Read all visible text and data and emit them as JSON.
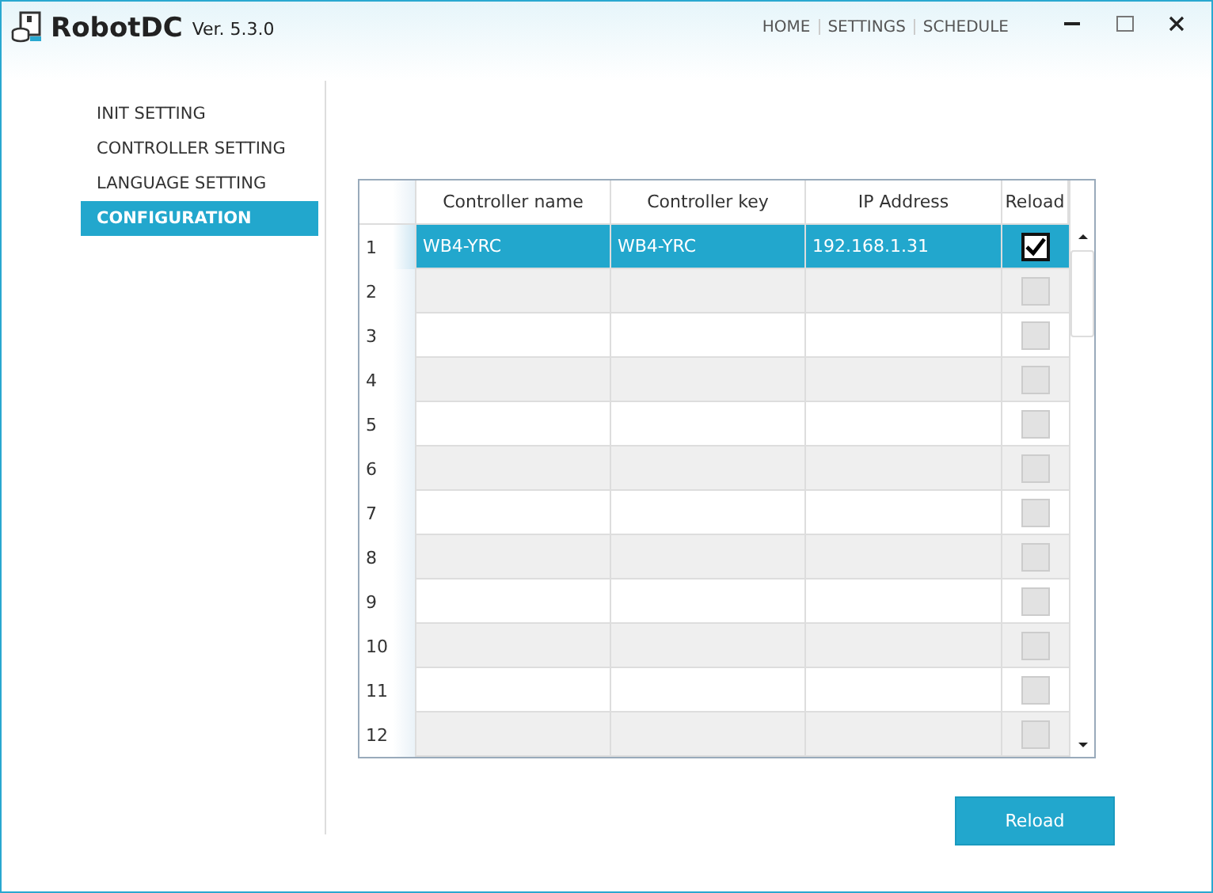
{
  "window": {
    "title": "RobotDC",
    "version": "Ver. 5.3.0"
  },
  "nav": [
    {
      "label": "HOME"
    },
    {
      "label": "SETTINGS"
    },
    {
      "label": "SCHEDULE"
    }
  ],
  "sidebar": {
    "items": [
      {
        "label": "INIT SETTING",
        "selected": false
      },
      {
        "label": "CONTROLLER SETTING",
        "selected": false
      },
      {
        "label": "LANGUAGE SETTING",
        "selected": false
      },
      {
        "label": "CONFIGURATION",
        "selected": true
      }
    ]
  },
  "table": {
    "columns": [
      "Controller name",
      "Controller key",
      "IP Address",
      "Reload"
    ],
    "rows": [
      {
        "index": "1",
        "name": "WB4-YRC",
        "key": "WB4-YRC",
        "ip": "192.168.1.31",
        "reload": true,
        "enabled": true,
        "selected": true
      },
      {
        "index": "2",
        "name": "",
        "key": "",
        "ip": "",
        "reload": false,
        "enabled": false,
        "selected": false
      },
      {
        "index": "3",
        "name": "",
        "key": "",
        "ip": "",
        "reload": false,
        "enabled": false,
        "selected": false
      },
      {
        "index": "4",
        "name": "",
        "key": "",
        "ip": "",
        "reload": false,
        "enabled": false,
        "selected": false
      },
      {
        "index": "5",
        "name": "",
        "key": "",
        "ip": "",
        "reload": false,
        "enabled": false,
        "selected": false
      },
      {
        "index": "6",
        "name": "",
        "key": "",
        "ip": "",
        "reload": false,
        "enabled": false,
        "selected": false
      },
      {
        "index": "7",
        "name": "",
        "key": "",
        "ip": "",
        "reload": false,
        "enabled": false,
        "selected": false
      },
      {
        "index": "8",
        "name": "",
        "key": "",
        "ip": "",
        "reload": false,
        "enabled": false,
        "selected": false
      },
      {
        "index": "9",
        "name": "",
        "key": "",
        "ip": "",
        "reload": false,
        "enabled": false,
        "selected": false
      },
      {
        "index": "10",
        "name": "",
        "key": "",
        "ip": "",
        "reload": false,
        "enabled": false,
        "selected": false
      },
      {
        "index": "11",
        "name": "",
        "key": "",
        "ip": "",
        "reload": false,
        "enabled": false,
        "selected": false
      },
      {
        "index": "12",
        "name": "",
        "key": "",
        "ip": "",
        "reload": false,
        "enabled": false,
        "selected": false
      }
    ]
  },
  "buttons": [
    "Reload"
  ]
}
